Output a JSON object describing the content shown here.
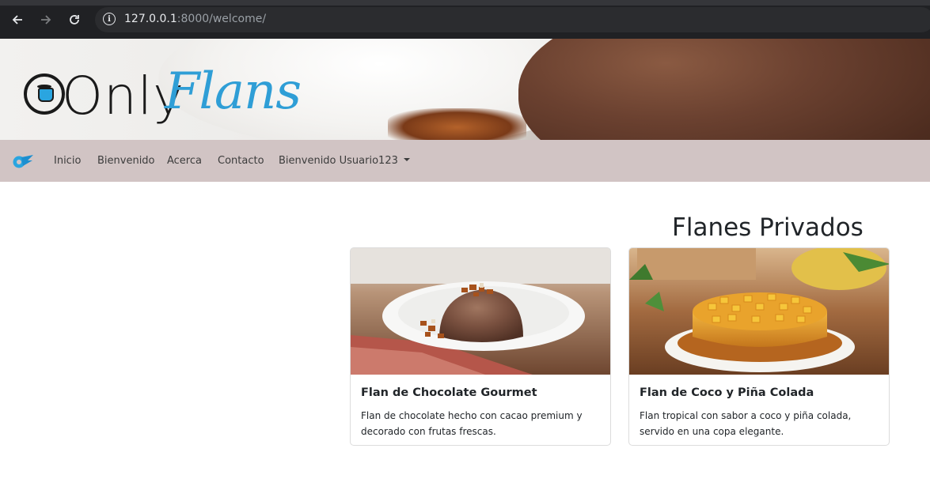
{
  "browser": {
    "url_host": "127.0.0.1",
    "url_path": ":8000/welcome/",
    "back_icon": "arrow-left-icon",
    "forward_icon": "arrow-right-icon",
    "reload_icon": "reload-icon",
    "site_info_icon": "info-icon"
  },
  "banner": {
    "logo_text_1": "Only",
    "logo_text_2": "Flans",
    "logo_color": "#2f9ed6"
  },
  "navbar": {
    "background": "#d1c4c4",
    "brand_icon": "onlyflans-brand-icon",
    "items": [
      {
        "label": "Inicio"
      },
      {
        "label": "Bienvenido"
      },
      {
        "label": "Acerca"
      },
      {
        "label": "Contacto"
      },
      {
        "label": "Bienvenido Usuario123"
      }
    ]
  },
  "main": {
    "title": "Flanes Privados",
    "cards": [
      {
        "title": "Flan de Chocolate Gourmet",
        "text": "Flan de chocolate hecho con cacao premium y decorado con frutas frescas."
      },
      {
        "title": "Flan de Coco y Piña Colada",
        "text": "Flan tropical con sabor a coco y piña colada, servido en una copa elegante."
      }
    ]
  }
}
